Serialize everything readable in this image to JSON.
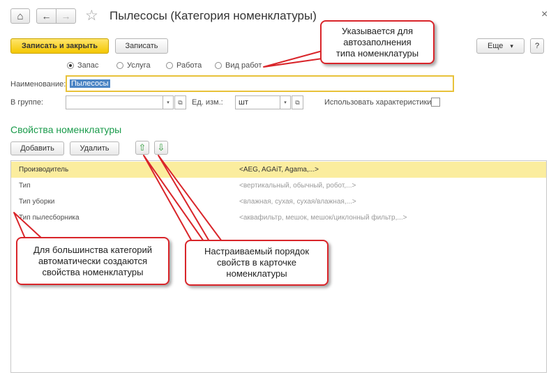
{
  "header": {
    "title": "Пылесосы (Категория номенклатуры)",
    "close_glyph": "×",
    "home_glyph": "⌂",
    "back_glyph": "←",
    "forward_glyph": "→",
    "star_glyph": "☆"
  },
  "toolbar": {
    "save_close_label": "Записать и закрыть",
    "save_label": "Записать",
    "more_label": "Еще",
    "more_arrow": "▾",
    "help_label": "?"
  },
  "type_radio": {
    "options": [
      {
        "label": "Запас",
        "selected": true
      },
      {
        "label": "Услуга",
        "selected": false
      },
      {
        "label": "Работа",
        "selected": false
      },
      {
        "label": "Вид работ",
        "selected": false
      }
    ]
  },
  "form": {
    "name_label": "Наименование:",
    "name_value": "Пылесосы",
    "group_label": "В группе:",
    "group_value": "",
    "unit_label": "Ед. изм.:",
    "unit_value": "шт",
    "use_chars_label": "Использовать характеристики:",
    "dropdown_glyph": "▾",
    "open_glyph": "⧉"
  },
  "properties": {
    "section_title": "Свойства номенклатуры",
    "add_label": "Добавить",
    "delete_label": "Удалить",
    "up_glyph": "⇧",
    "down_glyph": "⇩",
    "rows": [
      {
        "name": "Производитель",
        "values": "<AEG, AGAiT, Agama,...>",
        "selected": true
      },
      {
        "name": "Тип",
        "values": "<вертикальный, обычный, робот,...>",
        "selected": false
      },
      {
        "name": "Тип уборки",
        "values": "<влажная, сухая, сухая/влажная,...>",
        "selected": false
      },
      {
        "name": "Тип пылесборника",
        "values": "<аквафильтр, мешок, мешок/циклонный фильтр,...>",
        "selected": false
      }
    ]
  },
  "callouts": {
    "autofill": [
      "Указывается для",
      "автозаполнения",
      "типа номенклатуры"
    ],
    "auto_create": [
      "Для большинства категорий",
      "автоматически создаются",
      "свойства номенклатуры"
    ],
    "order": [
      "Настраиваемый порядок",
      "свойств в карточке",
      "номенклатуры"
    ]
  },
  "colors": {
    "accent_green": "#1a9b4b",
    "primary_yellow": "#f4c700",
    "selected_row": "#fbed9e",
    "callout_red": "#d9252a",
    "focus_border": "#e8c23a"
  }
}
